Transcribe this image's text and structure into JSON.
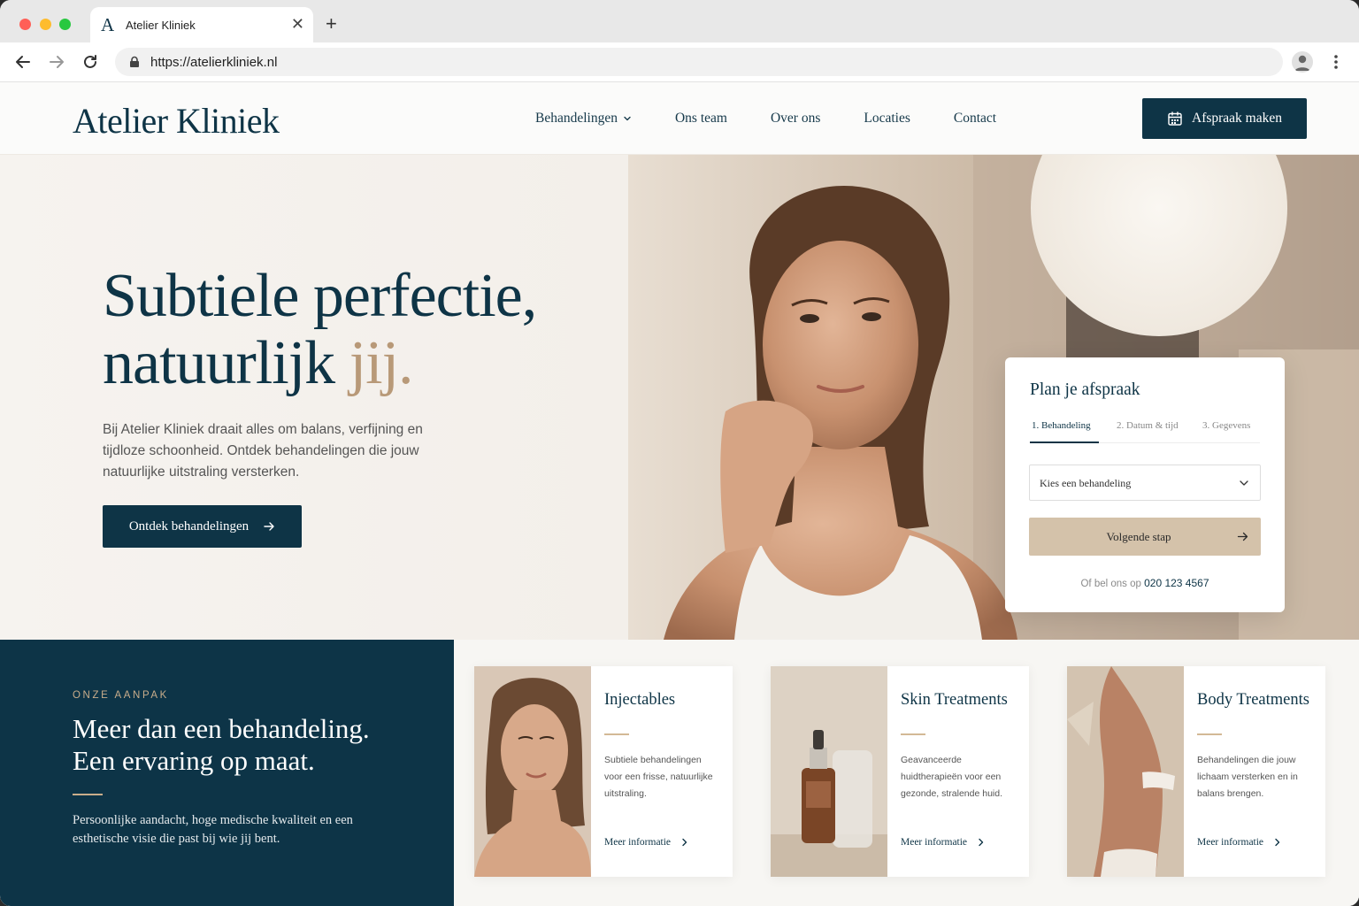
{
  "browser": {
    "tab_title": "Atelier Kliniek",
    "tab_favicon": "A",
    "url": "https://atelierkliniek.nl",
    "icons": [
      "back-icon",
      "forward-icon",
      "reload-icon",
      "lock-icon",
      "profile-icon",
      "kebab-menu-icon",
      "close-icon",
      "new-tab-icon"
    ]
  },
  "header": {
    "logo": "Atelier Kliniek",
    "menu": [
      {
        "label": "Behandelingen"
      },
      {
        "label": "Ons team"
      },
      {
        "label": "Over ons"
      },
      {
        "label": "Locaties"
      },
      {
        "label": "Contact"
      }
    ],
    "cta_label": "Afspraak maken"
  },
  "hero": {
    "title_line1": "Subtiele perfectie,",
    "title_line2_main": "natuurlijk ",
    "title_line2_accent": "jij.",
    "text": "Bij Atelier Kliniek draait alles om balans, verfijning en tijdloze schoonheid. Ontdek behandelingen die jouw natuurlijke uitstraling versterken.",
    "button_label": "Ontdek behandelingen"
  },
  "booking": {
    "title": "Plan je afspraak",
    "steps": [
      "1. Behandeling",
      "2. Datum & tijd",
      "3. Gegevens"
    ],
    "select_label": "Kies een behandeling",
    "next_label": "Volgende stap",
    "call_prefix": "Of bel ons op",
    "phone": "020 123 4567"
  },
  "approach": {
    "eyebrow": "ONZE AANPAK",
    "title_line1": "Meer dan een behandeling.",
    "title_line2": "Een ervaring op maat.",
    "text": "Persoonlijke aandacht, hoge medische kwaliteit en een esthetische visie die past bij wie jij bent."
  },
  "cards": [
    {
      "title": "Injectables",
      "desc": "Subtiele behandelingen voor een frisse, natuurlijke uitstraling.",
      "link": "Meer informatie"
    },
    {
      "title": "Skin Treatments",
      "desc": "Geavanceerde huidtherapieën voor een gezonde, stralende huid.",
      "link": "Meer informatie"
    },
    {
      "title": "Body Treatments",
      "desc": "Behandelingen die jouw lichaam versterken en in balans brengen.",
      "link": "Meer informatie"
    }
  ],
  "colors": {
    "navy": "#0e3446",
    "gold": "#b89978",
    "sand_button": "#d4c2aa"
  }
}
